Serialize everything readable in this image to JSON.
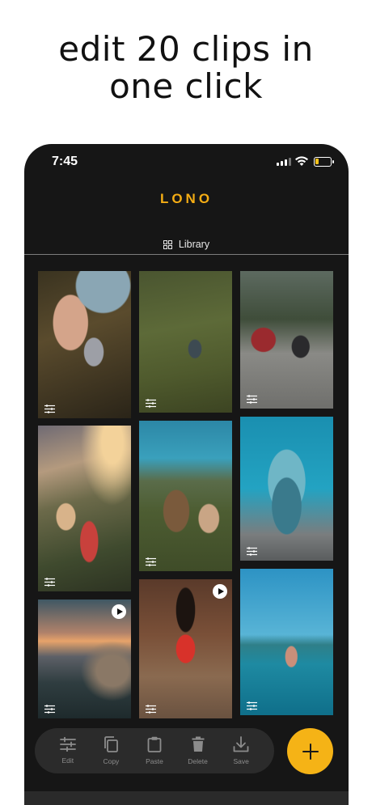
{
  "headline": {
    "line1": "edit 20 clips in",
    "line2": "one click"
  },
  "status_bar": {
    "time": "7:45"
  },
  "app": {
    "logo": "LONO",
    "tab_label": "Library",
    "accent_color": "#f5ad14"
  },
  "library": {
    "clips": [
      {
        "column": 1,
        "row": 1,
        "type": "photo",
        "adjust_icon": "sliders-icon"
      },
      {
        "column": 1,
        "row": 2,
        "type": "photo",
        "adjust_icon": "sliders-icon"
      },
      {
        "column": 1,
        "row": 3,
        "type": "video",
        "adjust_icon": "sliders-icon",
        "play_icon": "play-icon"
      },
      {
        "column": 2,
        "row": 1,
        "type": "photo",
        "adjust_icon": "sliders-icon"
      },
      {
        "column": 2,
        "row": 2,
        "type": "photo",
        "adjust_icon": "sliders-icon"
      },
      {
        "column": 2,
        "row": 3,
        "type": "video",
        "adjust_icon": "sliders-icon",
        "play_icon": "play-icon"
      },
      {
        "column": 3,
        "row": 1,
        "type": "photo",
        "adjust_icon": "sliders-icon"
      },
      {
        "column": 3,
        "row": 2,
        "type": "photo",
        "adjust_icon": "sliders-icon"
      },
      {
        "column": 3,
        "row": 3,
        "type": "photo",
        "adjust_icon": "sliders-icon"
      }
    ]
  },
  "toolbar": {
    "edit": "Edit",
    "copy": "Copy",
    "paste": "Paste",
    "delete": "Delete",
    "save": "Save"
  },
  "fab": {
    "icon": "plus-icon",
    "color": "#f5b316"
  }
}
